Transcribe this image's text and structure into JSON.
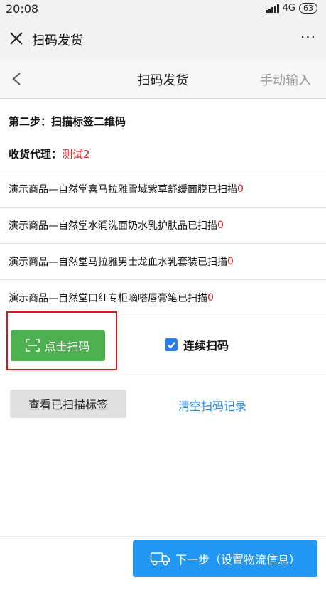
{
  "status_bar": {
    "time": "20:08",
    "network": "4G",
    "battery": "63"
  },
  "wechat_bar": {
    "title": "扫码发货",
    "more": "···"
  },
  "nav": {
    "title": "扫码发货",
    "manual_input": "手动输入"
  },
  "step_title": "第二步：扫描标签二维码",
  "agent": {
    "label": "收货代理：",
    "value": "测试2"
  },
  "items": [
    {
      "name": "演示商品—自然堂喜马拉雅雪域紫草舒缓面膜",
      "status": "已扫描",
      "count": "0"
    },
    {
      "name": "演示商品—自然堂水润洗面奶水乳护肤品",
      "status": "已扫描",
      "count": "0"
    },
    {
      "name": "演示商品—自然堂马拉雅男士龙血水乳套装",
      "status": "已扫描",
      "count": "0"
    },
    {
      "name": "演示商品—自然堂口红专柜嘀嗒唇膏笔",
      "status": "已扫描",
      "count": "0"
    }
  ],
  "scan_button": "点击扫码",
  "continuous_scan": {
    "label": "连续扫码",
    "checked": true
  },
  "view_scanned_button": "查看已扫描标签",
  "clear_records_link": "清空扫码记录",
  "next_button": "下一步（设置物流信息）",
  "colors": {
    "accent_green": "#4caf50",
    "accent_blue": "#2196f3",
    "link_blue": "#1e88e5",
    "red": "#e02020"
  }
}
